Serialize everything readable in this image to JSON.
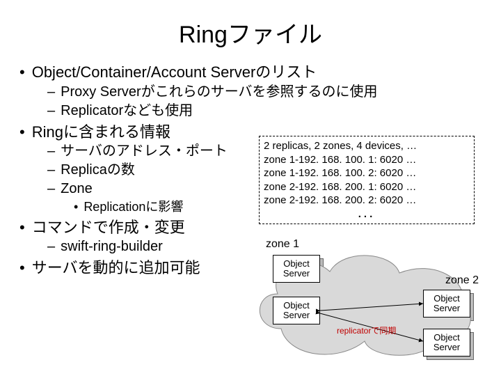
{
  "title": "Ringファイル",
  "bullets": {
    "b1": "Object/Container/Account Serverのリスト",
    "b1a": "Proxy Serverがこれらのサーバを参照するのに使用",
    "b1b": "Replicatorなども使用",
    "b2": "Ringに含まれる情報",
    "b2a": "サーバのアドレス・ポート",
    "b2b": "Replicaの数",
    "b2c": "Zone",
    "b2c1": "Replicationに影響",
    "b3": "コマンドで作成・変更",
    "b3a": "swift-ring-builder",
    "b4": "サーバを動的に追加可能"
  },
  "infobox": {
    "head": "2 replicas, 2 zones, 4 devices, …",
    "l1": "zone 1-192. 168. 100. 1: 6020 …",
    "l2": "zone 1-192. 168. 100. 2: 6020 …",
    "l3": "zone 2-192. 168. 200. 1: 6020 …",
    "l4": "zone 2-192. 168. 200. 2: 6020 …",
    "ellipsis": "..."
  },
  "diagram": {
    "zone1": "zone 1",
    "zone2": "zone 2",
    "obj_l1": "Object",
    "obj_l2": "Server",
    "replicator": "replicatorで同期"
  }
}
